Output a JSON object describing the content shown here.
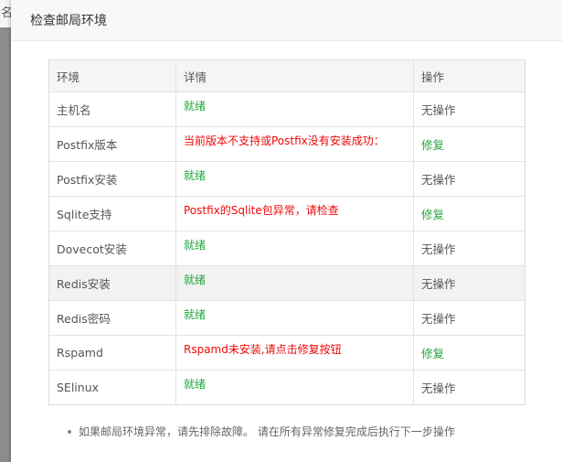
{
  "backdrop": {
    "label": "名"
  },
  "dialog": {
    "title": "检查邮局环境"
  },
  "table": {
    "headers": {
      "env": "环境",
      "detail": "详情",
      "action": "操作"
    },
    "rows": [
      {
        "env": "主机名",
        "detail": "就绪",
        "action": "无操作"
      },
      {
        "env": "Postfix版本",
        "detail": "当前版本不支持或Postfix没有安装成功：",
        "action": "修复"
      },
      {
        "env": "Postfix安装",
        "detail": "就绪",
        "action": "无操作"
      },
      {
        "env": "Sqlite支持",
        "detail": "Postfix的Sqlite包异常，请检查",
        "action": "修复"
      },
      {
        "env": "Dovecot安装",
        "detail": "就绪",
        "action": "无操作"
      },
      {
        "env": "Redis安装",
        "detail": "就绪",
        "action": "无操作"
      },
      {
        "env": "Redis密码",
        "detail": "就绪",
        "action": "无操作"
      },
      {
        "env": "Rspamd",
        "detail": "Rspamd未安装,请点击修复按钮",
        "action": "修复"
      },
      {
        "env": "SElinux",
        "detail": "就绪",
        "action": "无操作"
      }
    ]
  },
  "note": {
    "text": "如果邮局环境异常，请先排除故障。 请在所有异常修复完成后执行下一步操作"
  },
  "colors": {
    "ok": "#20a53a",
    "error": "#ef0808",
    "fix": "#20a53a"
  }
}
